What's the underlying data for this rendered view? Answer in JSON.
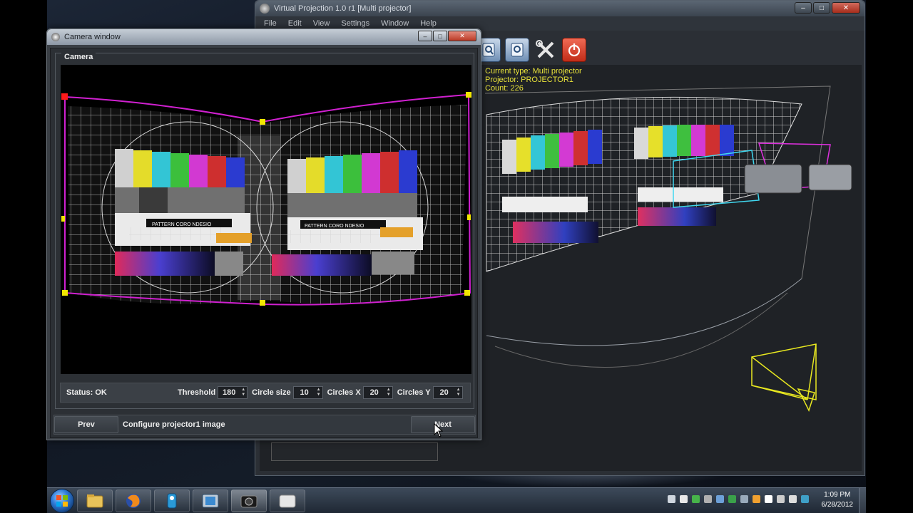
{
  "main_window": {
    "title": "Virtual Projection 1.0 r1 [Multi projector]",
    "menu": [
      "File",
      "Edit",
      "View",
      "Settings",
      "Window",
      "Help"
    ],
    "info_lines": [
      "Current type: Multi projector",
      "Projector: PROJECTOR1",
      "Count: 226"
    ],
    "controls": {
      "minimize": "–",
      "maximize": "□",
      "close": "✕"
    },
    "toolbar_icons": [
      "projector-preview-icon",
      "projector-view-icon",
      "tools-icon",
      "power-icon"
    ]
  },
  "camera_window": {
    "title": "Camera window",
    "group_label": "Camera",
    "controls": {
      "minimize": "–",
      "maximize": "□",
      "close": "✕"
    },
    "status": "Status: OK",
    "threshold": {
      "label": "Threshold",
      "value": "180"
    },
    "circle_size": {
      "label": "Circle size",
      "value": "10"
    },
    "circles_x": {
      "label": "Circles X",
      "value": "20"
    },
    "circles_y": {
      "label": "Circles Y",
      "value": "20"
    },
    "prev_label": "Prev",
    "caption": "Configure projector1 image",
    "next_label": "Next",
    "test_pattern_text": "PATTERN CORO NDESIO"
  },
  "taskbar": {
    "clock_time": "1:09 PM",
    "clock_date": "6/28/2012",
    "apps": [
      "windows-explorer-icon",
      "firefox-icon",
      "key-manager-icon",
      "virtual-projection-icon",
      "camera-app-icon",
      "viewer-icon"
    ]
  },
  "colors": {
    "selection_outline": "#d020d0",
    "handle": "#f2e600",
    "anchor_handle": "#ff1a1a",
    "info_text": "#e8e23a",
    "gizmo": "#e0e020"
  }
}
